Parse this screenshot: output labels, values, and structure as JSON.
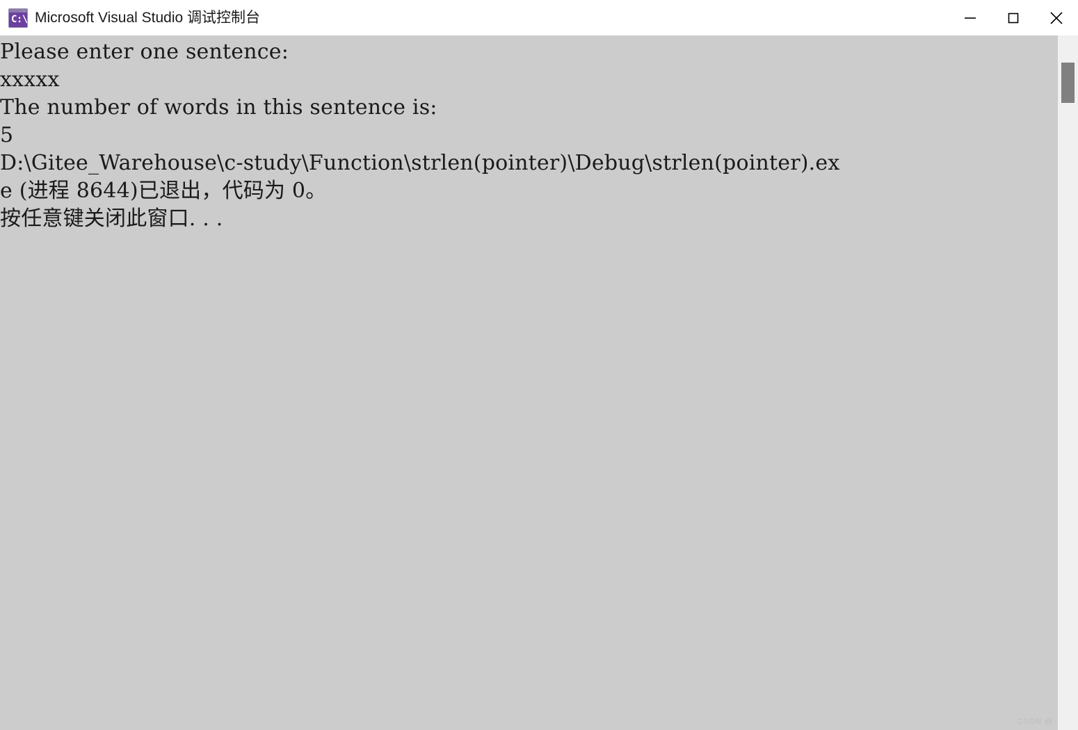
{
  "window": {
    "title": "Microsoft Visual Studio 调试控制台",
    "icon_name": "console-app-icon",
    "icon_glyph": "C:\\",
    "icon_color": "#6b3fa0",
    "titlebar_background": "#ffffff",
    "console_background": "#cccccc",
    "console_foreground": "#1a1a1a"
  },
  "controls": {
    "minimize_label": "最小化",
    "maximize_label": "最大化",
    "close_label": "关闭"
  },
  "console": {
    "lines": [
      "Please enter one sentence:",
      "xxxxx",
      "The number of words in this sentence is:",
      "5",
      "D:\\Gitee_Warehouse\\c-study\\Function\\strlen(pointer)\\Debug\\strlen(pointer).ex",
      "e (进程 8644)已退出，代码为 0。",
      "按任意键关闭此窗口. . ."
    ],
    "text": "Please enter one sentence:\nxxxxx\nThe number of words in this sentence is:\n5\nD:\\Gitee_Warehouse\\c-study\\Function\\strlen(pointer)\\Debug\\strlen(pointer).ex\ne (进程 8644)已退出，代码为 0。\n按任意键关闭此窗口. . .",
    "prompt": "Please enter one sentence:",
    "user_input": "xxxxx",
    "result_label": "The number of words in this sentence is:",
    "result_value": "5",
    "executable_path": "D:\\Gitee_Warehouse\\c-study\\Function\\strlen(pointer)\\Debug\\strlen(pointer).exe",
    "process_id": "8644",
    "exit_code": "0",
    "exit_message": "e (进程 8644)已退出，代码为 0。",
    "close_hint": "按任意键关闭此窗口. . ."
  },
  "scrollbar": {
    "track_color": "#f0f0f0",
    "thumb_color": "#808080"
  },
  "watermark": {
    "text": "CSDN @️"
  }
}
